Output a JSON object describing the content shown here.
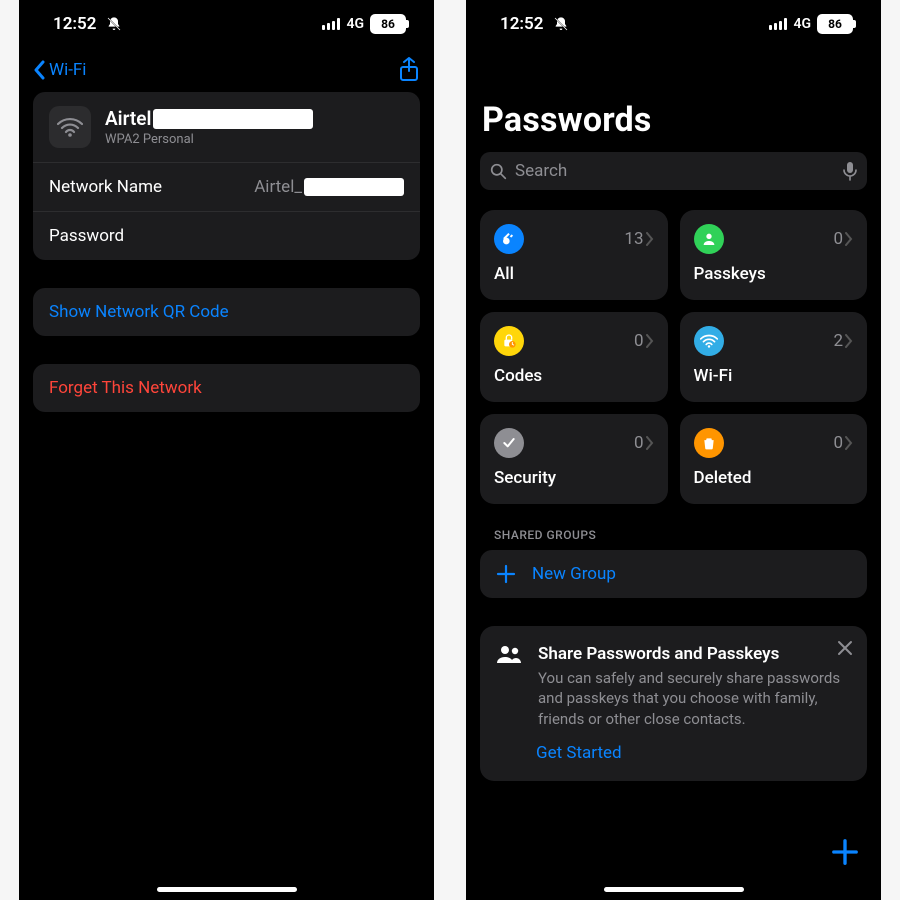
{
  "status": {
    "time": "12:52",
    "network": "4G",
    "battery": "86"
  },
  "left": {
    "back_label": "Wi-Fi",
    "network": {
      "name_visible": "Airtel",
      "security": "WPA2 Personal",
      "rows": {
        "name_label": "Network Name",
        "name_value": "Airtel_",
        "password_label": "Password"
      }
    },
    "show_qr": "Show Network QR Code",
    "forget": "Forget This Network"
  },
  "right": {
    "title": "Passwords",
    "search_placeholder": "Search",
    "categories": [
      {
        "id": "all",
        "label": "All",
        "count": "13",
        "icon_bg": "#0a84ff"
      },
      {
        "id": "passkeys",
        "label": "Passkeys",
        "count": "0",
        "icon_bg": "#30d158"
      },
      {
        "id": "codes",
        "label": "Codes",
        "count": "0",
        "icon_bg": "#ffd60a"
      },
      {
        "id": "wifi",
        "label": "Wi-Fi",
        "count": "2",
        "icon_bg": "#32ade6"
      },
      {
        "id": "security",
        "label": "Security",
        "count": "0",
        "icon_bg": "#8e8e93"
      },
      {
        "id": "deleted",
        "label": "Deleted",
        "count": "0",
        "icon_bg": "#ff9500"
      }
    ],
    "shared_section": "SHARED GROUPS",
    "new_group": "New Group",
    "share": {
      "title": "Share Passwords and Passkeys",
      "body": "You can safely and securely share passwords and passkeys that you choose with family, friends or other close contacts.",
      "cta": "Get Started"
    }
  }
}
